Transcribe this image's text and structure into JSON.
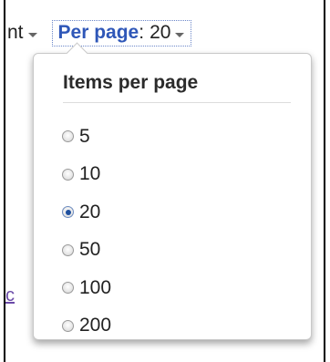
{
  "toolbar": {
    "sort_fragment": "nt",
    "per_page_label": "Per page",
    "per_page_colon": ":",
    "per_page_value": "20"
  },
  "background_link_fragment": "c",
  "popup": {
    "title": "Items per page",
    "options": [
      {
        "label": "5",
        "checked": false
      },
      {
        "label": "10",
        "checked": false
      },
      {
        "label": "20",
        "checked": true
      },
      {
        "label": "50",
        "checked": false
      },
      {
        "label": "100",
        "checked": false
      },
      {
        "label": "200",
        "checked": false
      }
    ]
  },
  "colors": {
    "link_blue": "#2f57b8",
    "radio_selected": "#1e4f9e",
    "visited_link": "#6a4aa8"
  },
  "icons": {
    "caret": "chevron-down-icon",
    "radio": "radio-icon"
  }
}
